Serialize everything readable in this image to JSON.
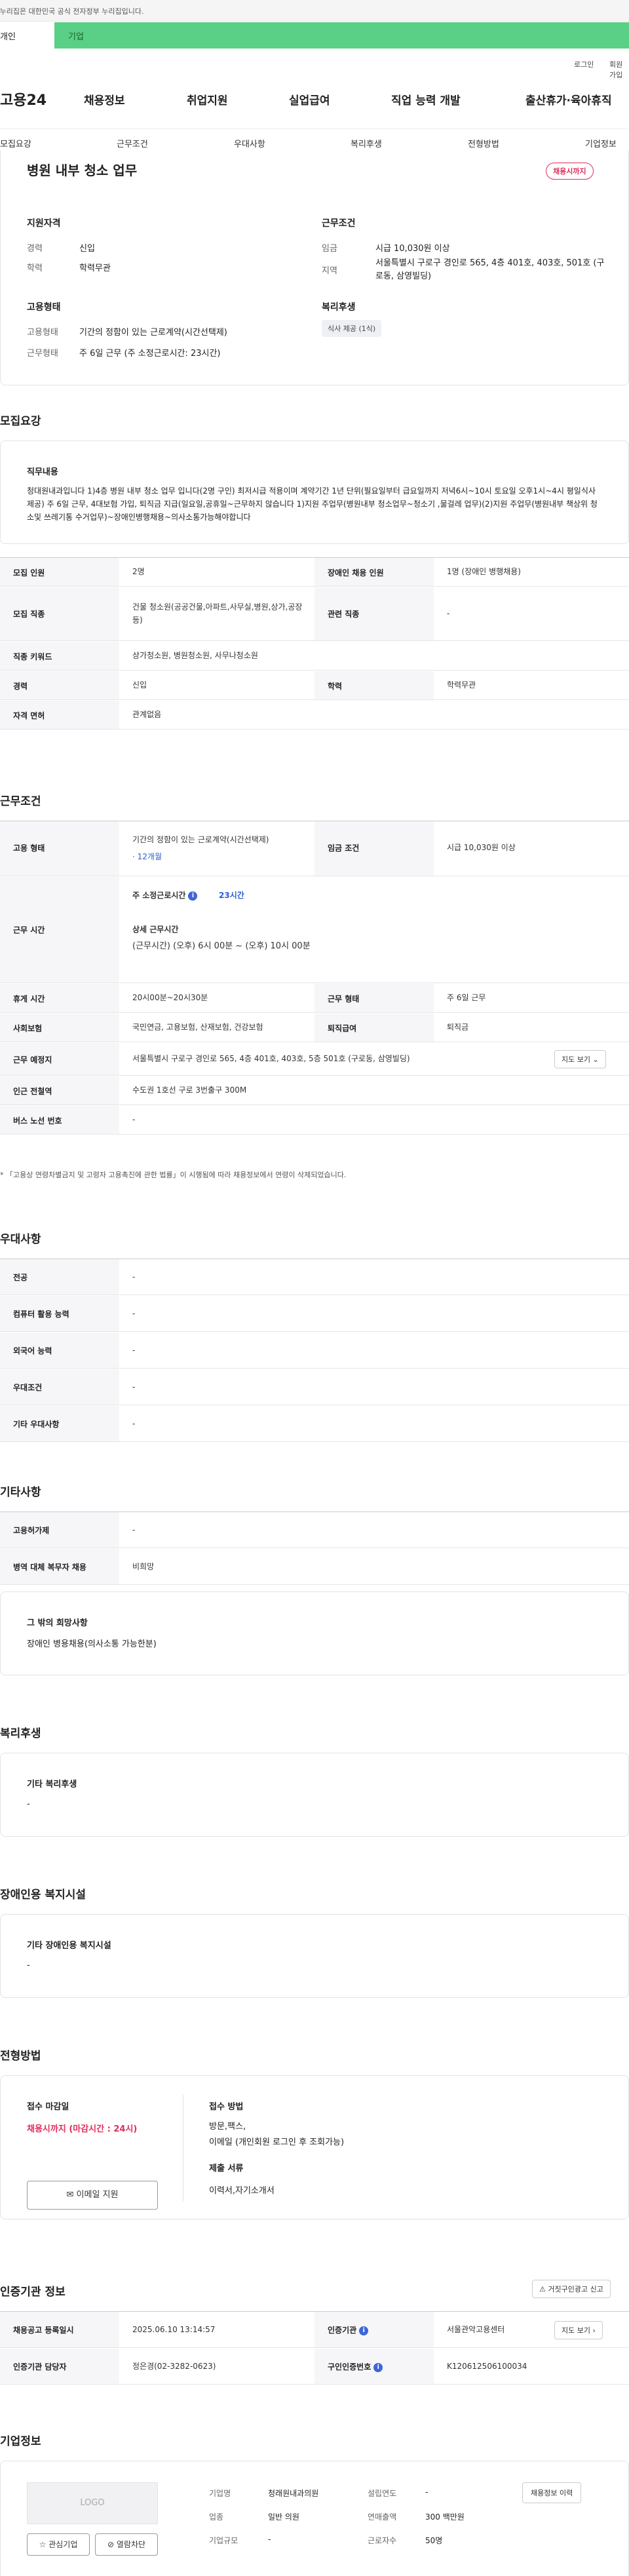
{
  "gov_bar": {
    "text": "이 누리집은 대한민국 공식 전자정부 누리집입니다."
  },
  "top_tabs": {
    "personal": "개인",
    "company": "기업"
  },
  "util": {
    "login": "로그인",
    "join": "회원가입"
  },
  "logo": "고용24",
  "gnb": [
    "채용정보",
    "취업지원",
    "실업급여",
    "직업 능력 개발",
    "출산휴가·육아휴직"
  ],
  "anchor_tabs": [
    "모집요강",
    "근무조건",
    "우대사항",
    "복리후생",
    "전형방법",
    "기업정보"
  ],
  "summary": {
    "title": "병원 내부 청소 업무",
    "deadline_badge": "채용시까지",
    "qualify_title": "지원자격",
    "career_label": "경력",
    "career_value": "신입",
    "edu_label": "학력",
    "edu_value": "학력무관",
    "work_title": "근무조건",
    "wage_label": "임금",
    "wage_value": "시급 10,030원 이상",
    "area_label": "지역",
    "area_value": "서울특별시 구로구 경인로 565, 4층 401호, 403호, 501호 (구로동, 삼영빌딩)",
    "emp_title": "고용형태",
    "emp_type_label": "고용형태",
    "emp_type_value": "기간의 정함이 있는 근로계약(시간선택제)",
    "work_form_label": "근무형태",
    "work_form_value": "주 6일 근무 (주 소정근로시간: 23시간)",
    "welfare_title": "복리후생",
    "welfare_chip": "식사 제공 (1식)"
  },
  "recruit": {
    "section_title": "모집요강",
    "duty_title": "직무내용",
    "duty_text": "청대원내과입니다     1)4층 병원 내부 청소 업무 입니다(2명 구인)   최저시급 적용이며     계약기간 1년 단위(필요일부터 급요일까지 저녁6시~10시     토요일 오후1시~4시 평일식사 제공)   주 6일 근무, 4대보험 가입, 퇴직금 지급(일요일,공휴일~근무하지 않습니다     1)지원 주업무(병원내부 청소업무~청소기 ,물걸레 업무)(2)지원 주업무(병원내부 책상위 청소및 쓰레기통 수거업무)~장애인병행채용~의사소통가능해야합니다",
    "rows": [
      {
        "l1": "모집 인원",
        "v1": "2명",
        "l2": "장애인 채용 인원",
        "v2": "1명 (장애인 병행채용)"
      },
      {
        "l1": "모집 직종",
        "v1": "건물 청소원(공공건물,아파트,사무실,병원,상가,공장 등)",
        "l2": "관련 직종",
        "v2": "-"
      },
      {
        "l1": "직종 키워드",
        "v1": "상가청소원, 병원청소원, 사무나청소원",
        "l2": "",
        "v2": ""
      },
      {
        "l1": "경력",
        "v1": "신입",
        "l2": "학력",
        "v2": "학력무관"
      },
      {
        "l1": "자격 면허",
        "v1": "관계없음",
        "l2": "",
        "v2": ""
      }
    ]
  },
  "conditions": {
    "section_title": "근무조건",
    "emp_label": "고용 형태",
    "emp_value": "기간의 정함이 있는 근로계약(시간선택제)",
    "emp_period": "· 12개월",
    "wage_label": "임금 조건",
    "wage_value": "시급 10,030원 이상",
    "time_label": "근무 시간",
    "time_weekly": "주 소정근로시간",
    "time_weekly_value": "23시간",
    "time_detail_title": "상세 근무시간",
    "time_detail": "(근무시간) (오후) 6시 00분 ~ (오후) 10시 00분",
    "rest_label": "휴게 시간",
    "rest_value": "20시00분~20시30분",
    "form_label": "근무 형태",
    "form_value": "주 6일 근무",
    "ins_label": "사회보험",
    "ins_value": "국민연금, 고용보험, 산재보험, 건강보험",
    "retire_label": "퇴직급여",
    "retire_value": "퇴직금",
    "place_label": "근무 예정지",
    "place_value": "서울특별시 구로구 경인로 565, 4층 401호, 403호, 5층 501호 (구로동, 삼영빌딩)",
    "map_btn": "지도 보기",
    "station_label": "인근 전철역",
    "station_value": "수도권 1호선 구로 3번출구 300M",
    "bus_label": "버스 노선 번호",
    "bus_value": "-",
    "note": "* 「고용상 연령차별금지 및 고령자 고용촉진에 관한 법률」이 시행됨에 따라 채용정보에서 연령이 삭제되었습니다."
  },
  "preference": {
    "section_title": "우대사항",
    "rows": [
      {
        "l": "전공",
        "v": "-"
      },
      {
        "l": "컴퓨터 활용 능력",
        "v": "-"
      },
      {
        "l": "외국어 능력",
        "v": "-"
      },
      {
        "l": "우대조건",
        "v": "-"
      },
      {
        "l": "기타 우대사항",
        "v": "-"
      }
    ]
  },
  "other": {
    "section_title": "기타사항",
    "rows": [
      {
        "l": "고용허가제",
        "v": "-"
      },
      {
        "l": "병역 대체 복무자 채용",
        "v": "비희망"
      }
    ],
    "hope_title": "그 밖의 희망사항",
    "hope_text": "장애인 병용채용(의사소통 가능한분)"
  },
  "welfare": {
    "section_title": "복리후생",
    "box_title": "기타 복리후생",
    "box_value": "-"
  },
  "disabled": {
    "section_title": "장애인용 복지시설",
    "box_title": "기타 장애인용 복지시설",
    "box_value": "-"
  },
  "selection": {
    "section_title": "전형방법",
    "deadline_title": "접수 마감일",
    "deadline_value": "채용시까지 (마감시간 : 24시)",
    "email_btn": "이메일 지원",
    "method_title": "접수 방법",
    "method_lines": [
      "방문,팩스,",
      "이메일 (개인회원 로그인 후 조회가능)"
    ],
    "docs_title": "제출 서류",
    "docs_value": "이력서,자기소개서"
  },
  "cert": {
    "section_title": "인증기관 정보",
    "report_btn": "거짓구인광고 신고",
    "reg_label": "채용공고 등록일시",
    "reg_value": "2025.06.10 13:14:57",
    "org_label": "인증기관",
    "org_value": "서울관악고용센터",
    "map_btn": "지도 보기",
    "staff_label": "인증기관 담당자",
    "staff_value": "정은경(02-3282-0623)",
    "num_label": "구인인증번호",
    "num_value": "K120612506100034"
  },
  "company": {
    "section_title": "기업정보",
    "logo_text": "LOGO",
    "fav_btn": "관심기업",
    "block_btn": "열람차단",
    "name_label": "기업명",
    "name_value": "청래원내과의원",
    "year_label": "설립연도",
    "year_value": "-",
    "biz_label": "업종",
    "biz_value": "일반 의원",
    "sales_label": "연매출액",
    "sales_value": "300 백만원",
    "size_label": "기업규모",
    "size_value": "-",
    "emp_label": "근로자수",
    "emp_value": "50명",
    "history_btn": "채용정보 이력"
  }
}
